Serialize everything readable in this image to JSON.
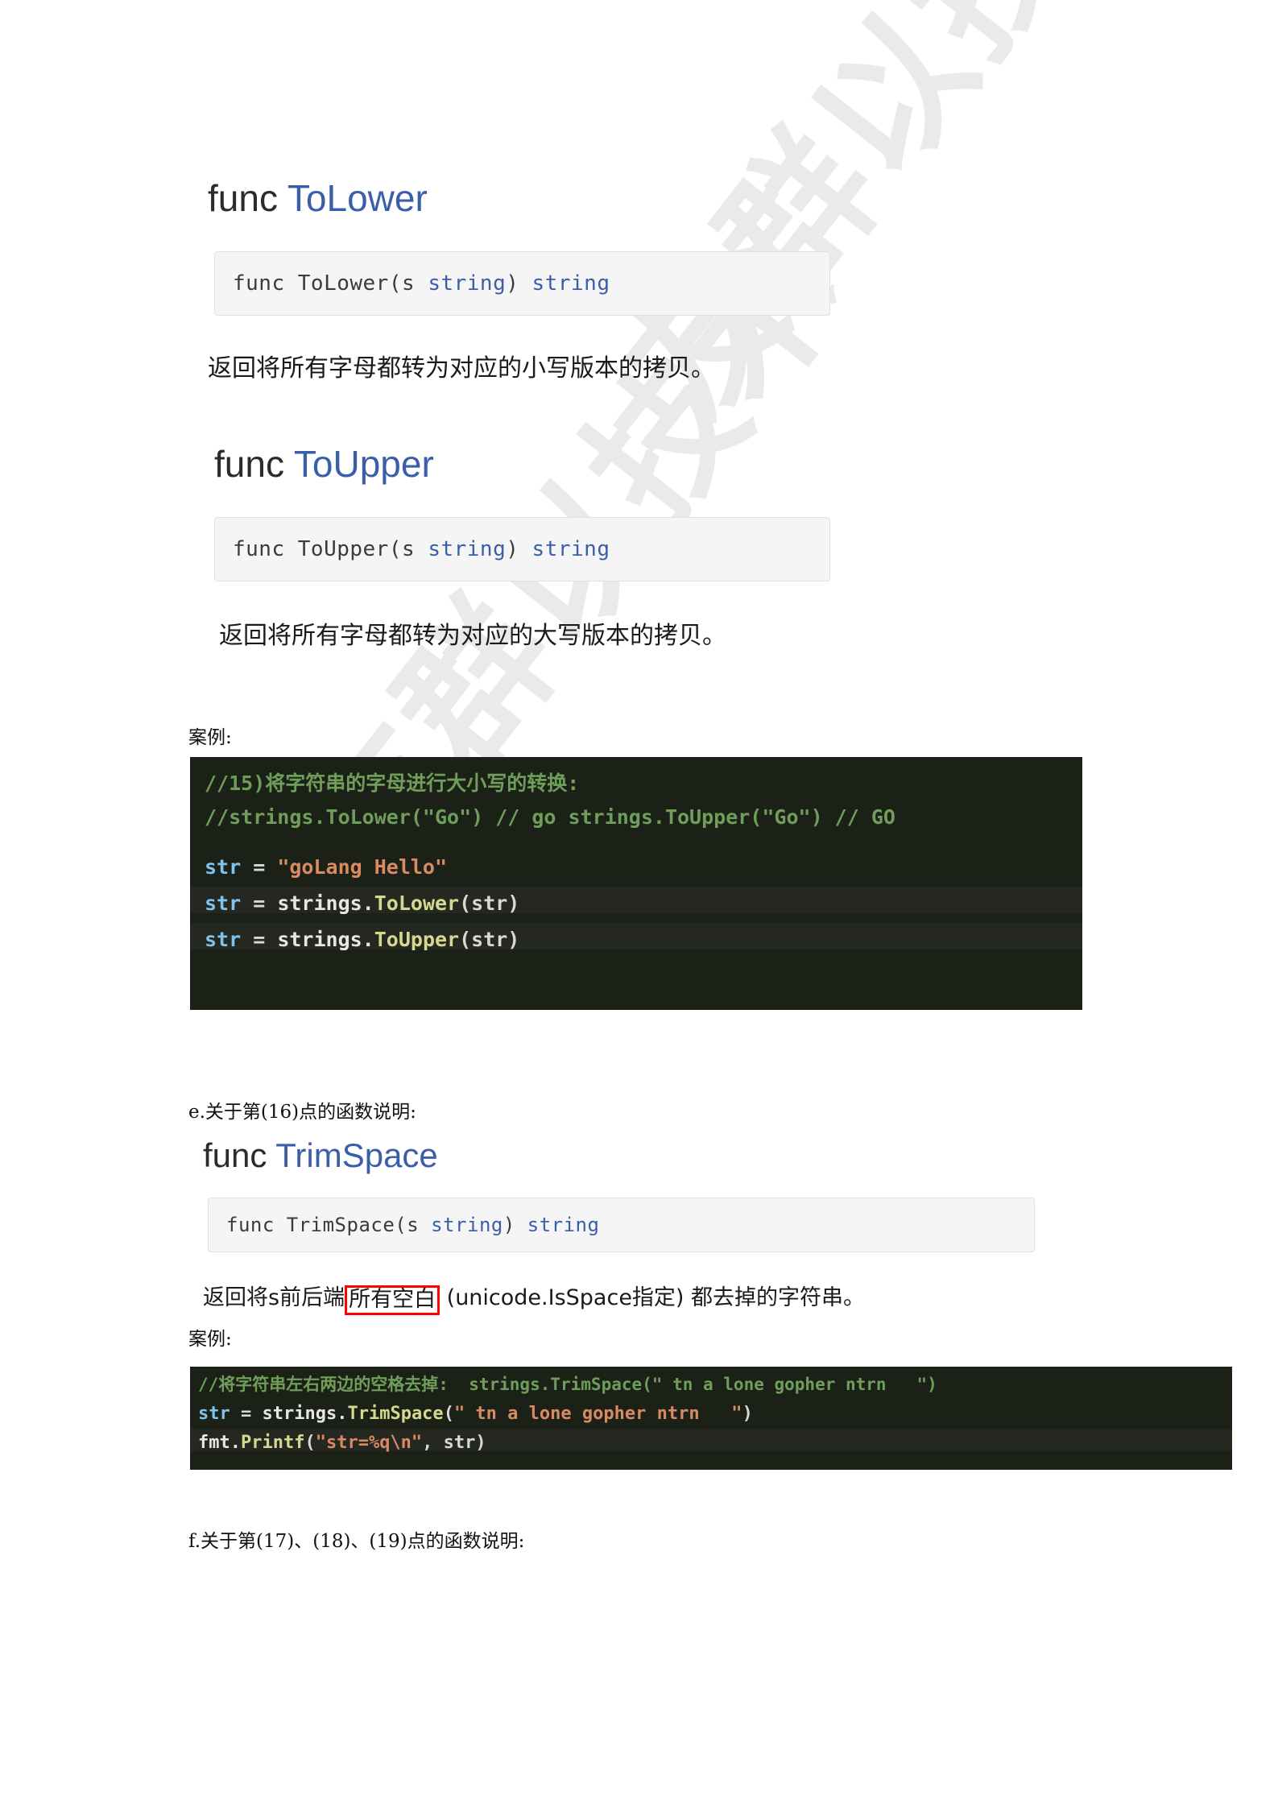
{
  "document": {
    "watermark_text": "友群以技术"
  },
  "sections": [
    {
      "id": "tolower",
      "heading_prefix": "func ",
      "heading_name": "ToLower",
      "signature": {
        "before": "func ToLower(s ",
        "type1": "string",
        "middle": ") ",
        "type2": "string"
      },
      "description": "返回将所有字母都转为对应的小写版本的拷贝。"
    },
    {
      "id": "toupper",
      "heading_prefix": "func ",
      "heading_name": "ToUpper",
      "signature": {
        "before": "func ToUpper(s ",
        "type1": "string",
        "middle": ") ",
        "type2": "string"
      },
      "description": "返回将所有字母都转为对应的大写版本的拷贝。"
    },
    {
      "id": "trimspace",
      "heading_prefix": "func ",
      "heading_name": "TrimSpace",
      "signature": {
        "before": "func TrimSpace(s ",
        "type1": "string",
        "middle": ") ",
        "type2": "string"
      },
      "description_part1": "返回将s前后端",
      "description_highlight": "所有空白",
      "description_part2": " (unicode.IsSpace指定) 都去掉的字符串。"
    }
  ],
  "labels": {
    "example_1": "案例:",
    "example_2": "案例:",
    "section_e": "e.关于第(16)点的函数说明:",
    "section_f": "f.关于第(17)、(18)、(19)点的函数说明:"
  },
  "code_shot_1": {
    "lines": [
      {
        "segments": [
          {
            "text": "//15)将字符串的字母进行大小写的转换:",
            "cls": "c-comment"
          }
        ]
      },
      {
        "segments": [
          {
            "text": "//strings.ToLower(\"Go\") // go strings.ToUpper(\"Go\") // GO",
            "cls": "c-comment"
          }
        ]
      },
      {
        "segments": [
          {
            "text": "str",
            "cls": "c-var"
          },
          {
            "text": " = ",
            "cls": "c-op"
          },
          {
            "text": "\"goLang Hello\"",
            "cls": "c-str"
          }
        ]
      },
      {
        "segments": [
          {
            "text": "str",
            "cls": "c-var"
          },
          {
            "text": " = ",
            "cls": "c-op"
          },
          {
            "text": "strings.",
            "cls": "c-pkg"
          },
          {
            "text": "ToLower",
            "cls": "c-fn"
          },
          {
            "text": "(str)",
            "cls": "c-punct"
          }
        ]
      },
      {
        "segments": [
          {
            "text": "str",
            "cls": "c-var"
          },
          {
            "text": " = ",
            "cls": "c-op"
          },
          {
            "text": "strings.",
            "cls": "c-pkg"
          },
          {
            "text": "ToUpper",
            "cls": "c-fn"
          },
          {
            "text": "(str)",
            "cls": "c-punct"
          }
        ]
      }
    ]
  },
  "code_shot_2": {
    "lines": [
      {
        "segments": [
          {
            "text": "//将字符串左右两边的空格去掉:  strings.TrimSpace(\" tn a lone gopher ntrn   \")",
            "cls": "c-comment"
          }
        ]
      },
      {
        "segments": [
          {
            "text": "str",
            "cls": "c-var"
          },
          {
            "text": " = ",
            "cls": "c-op"
          },
          {
            "text": "strings.",
            "cls": "c-pkg"
          },
          {
            "text": "TrimSpace",
            "cls": "c-fn"
          },
          {
            "text": "(",
            "cls": "c-punct"
          },
          {
            "text": "\" tn a lone gopher ntrn   \"",
            "cls": "c-str"
          },
          {
            "text": ")",
            "cls": "c-punct"
          }
        ]
      },
      {
        "segments": [
          {
            "text": "fmt.",
            "cls": "c-pkg"
          },
          {
            "text": "Printf",
            "cls": "c-fn"
          },
          {
            "text": "(",
            "cls": "c-punct"
          },
          {
            "text": "\"str=%q\\n\"",
            "cls": "c-str"
          },
          {
            "text": ", str)",
            "cls": "c-punct"
          }
        ]
      }
    ]
  },
  "colors": {
    "heading_name": "#3a5fa8",
    "sig_bg": "#f5f5f5",
    "sig_border": "#e0e0e0",
    "code_bg": "#1c2118",
    "highlight_box": "#ff0000",
    "watermark": "#eaeaea"
  }
}
